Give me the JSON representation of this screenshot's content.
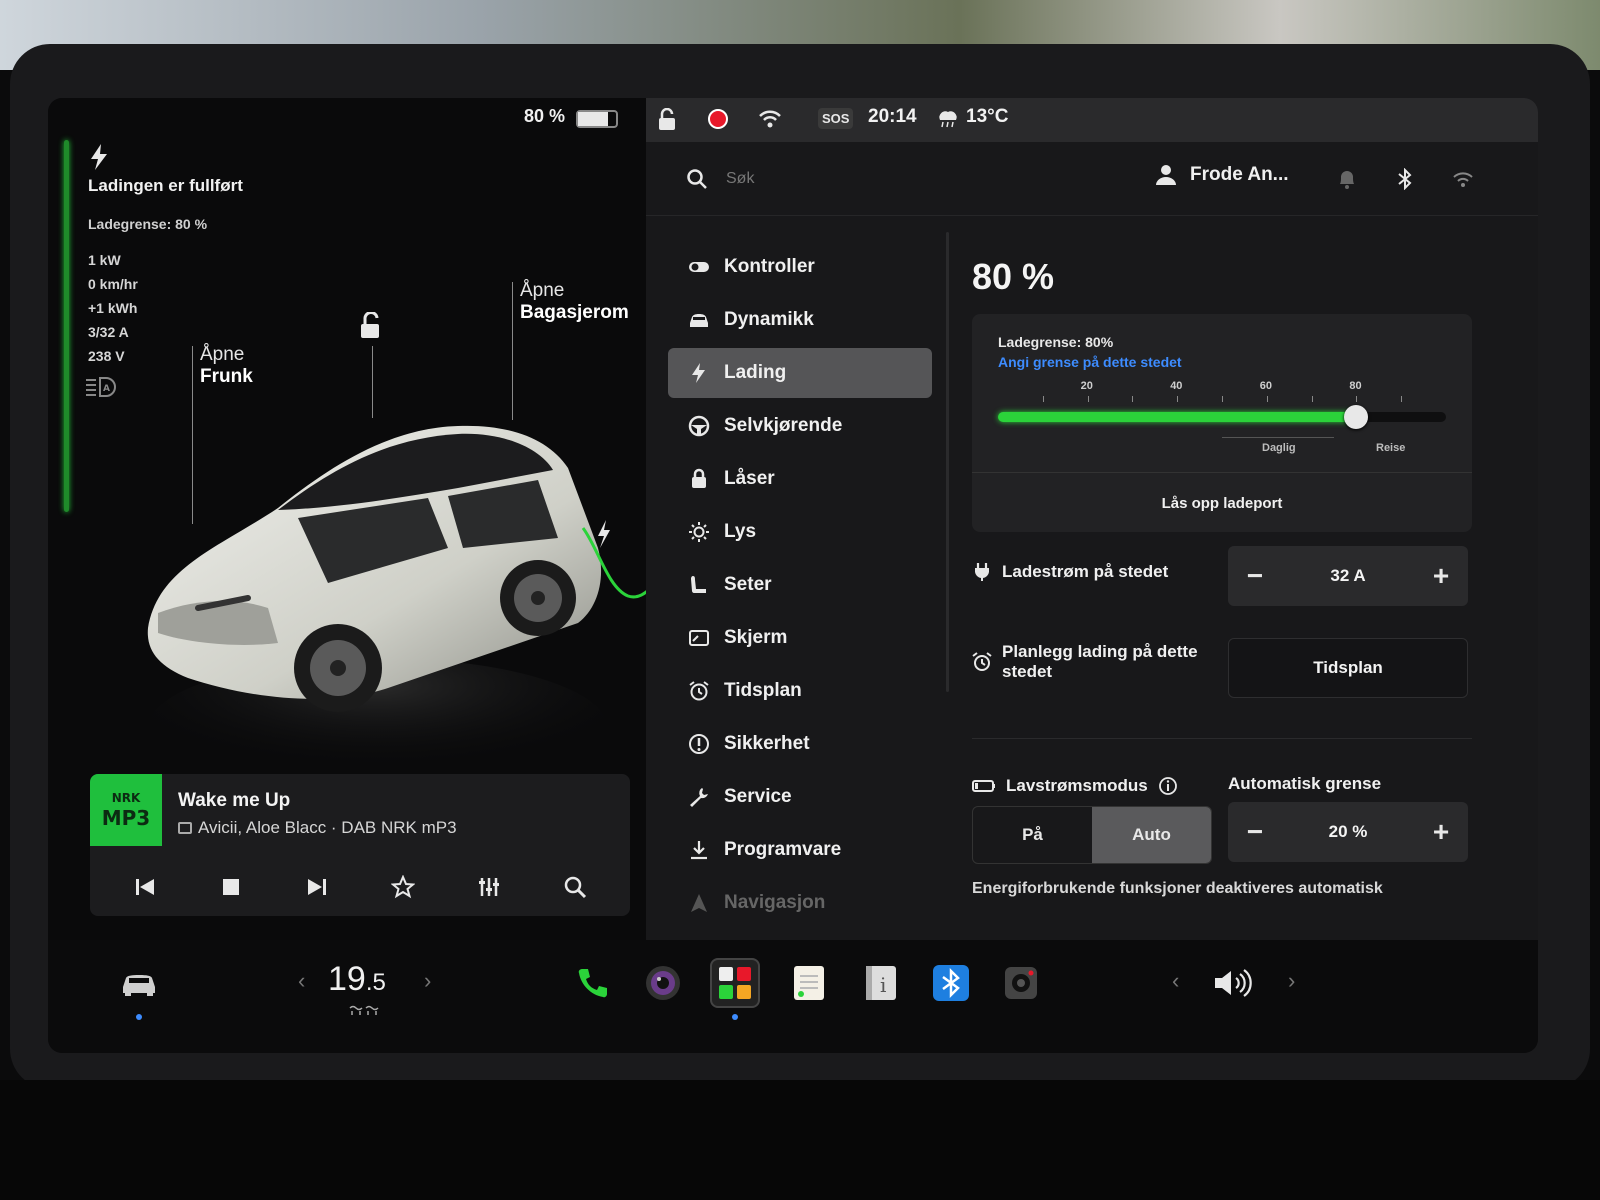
{
  "status_bar": {
    "battery_percent": "80 %",
    "battery_level": 0.8,
    "sos": "SOS",
    "time": "20:14",
    "temperature": "13°C"
  },
  "car_panel": {
    "status_title": "Ladingen er fullført",
    "charge_limit": "Ladegrense: 80 %",
    "stats": [
      "1 kW",
      "0 km/hr",
      "+1 kWh",
      "3/32 A",
      "238 V"
    ],
    "frunk_label_1": "Åpne",
    "frunk_label_2": "Frunk",
    "trunk_label_1": "Åpne",
    "trunk_label_2": "Bagasjerom"
  },
  "player": {
    "art_line1": "NRK",
    "art_line2": "MP3",
    "title": "Wake me Up",
    "subtitle": "Avicii, Aloe Blacc · DAB NRK mP3"
  },
  "header": {
    "search_placeholder": "Søk",
    "user_name": "Frode An..."
  },
  "nav": {
    "items": [
      {
        "label": "Kontroller",
        "icon": "toggle-icon"
      },
      {
        "label": "Dynamikk",
        "icon": "car-icon"
      },
      {
        "label": "Lading",
        "icon": "bolt-icon",
        "active": true
      },
      {
        "label": "Selvkjørende",
        "icon": "steering-wheel-icon"
      },
      {
        "label": "Låser",
        "icon": "lock-icon"
      },
      {
        "label": "Lys",
        "icon": "sun-icon"
      },
      {
        "label": "Seter",
        "icon": "seat-icon"
      },
      {
        "label": "Skjerm",
        "icon": "display-icon"
      },
      {
        "label": "Tidsplan",
        "icon": "alarm-clock-icon"
      },
      {
        "label": "Sikkerhet",
        "icon": "alert-icon"
      },
      {
        "label": "Service",
        "icon": "wrench-icon"
      },
      {
        "label": "Programvare",
        "icon": "download-icon"
      },
      {
        "label": "Navigasjon",
        "icon": "navigation-icon"
      }
    ]
  },
  "charging": {
    "percent": "80 %",
    "limit_title": "Ladegrense: 80%",
    "limit_link": "Angi grense på dette stedet",
    "slider_value": 80,
    "tick_labels": [
      "20",
      "40",
      "60",
      "80"
    ],
    "range_daily": "Daglig",
    "range_trip": "Reise",
    "unlock_port": "Lås opp ladeport",
    "current_label": "Ladestrøm på stedet",
    "current_value": "32  A",
    "schedule_label_1": "Planlegg lading på dette",
    "schedule_label_2": "stedet",
    "schedule_button": "Tidsplan",
    "low_power_label": "Lavstrømsmodus",
    "low_power_on": "På",
    "low_power_auto": "Auto",
    "auto_limit_title": "Automatisk grense",
    "auto_limit_value": "20 %",
    "footnote": "Energiforbrukende funksjoner deaktiveres automatisk"
  },
  "dock": {
    "temp_main": "19",
    "temp_decimal": ".5"
  },
  "colors": {
    "accent_green": "#2bd33a",
    "link_blue": "#3d8cff",
    "record_red": "#e8182a"
  }
}
